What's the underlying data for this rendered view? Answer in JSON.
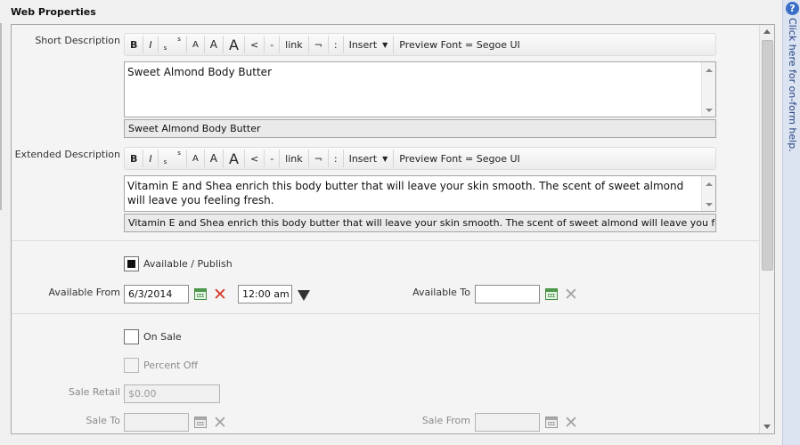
{
  "section": {
    "title": "Web Properties"
  },
  "toolbar": {
    "bold": "B",
    "italic": "I",
    "sub": "s",
    "sup": "s",
    "font_small": "A",
    "font_medium": "A",
    "font_large": "A",
    "indent_less": "<",
    "indent_dash": "-",
    "link": "link",
    "not": "¬",
    "colon": ":",
    "insert": "Insert",
    "preview_font": "Preview Font = Segoe UI"
  },
  "short_description": {
    "label": "Short Description",
    "editor_text": "Sweet Almond Body Butter",
    "preview_text": "Sweet Almond Body Butter"
  },
  "extended_description": {
    "label": "Extended Description",
    "editor_text": "Vitamin E and Shea enrich this body butter that will leave your skin smooth. The scent of sweet almond will leave you feeling fresh.",
    "preview_text": "Vitamin E and Shea enrich this body butter that will leave your skin smooth. The scent of sweet almond will leave you fee"
  },
  "availability": {
    "publish_label": "Available / Publish",
    "publish_checked": true,
    "available_from_label": "Available From",
    "available_from_date": "6/3/2014",
    "available_from_time": "12:00 am",
    "available_to_label": "Available To",
    "available_to_date": ""
  },
  "sale": {
    "on_sale_label": "On Sale",
    "on_sale_checked": false,
    "percent_off_label": "Percent Off",
    "sale_retail_label": "Sale Retail",
    "sale_retail_value": "$0.00",
    "sale_to_label": "Sale To",
    "sale_to_value": "",
    "sale_from_label": "Sale From",
    "sale_from_value": ""
  },
  "help": {
    "text": "Click here for on-form help.",
    "icon": "?"
  }
}
